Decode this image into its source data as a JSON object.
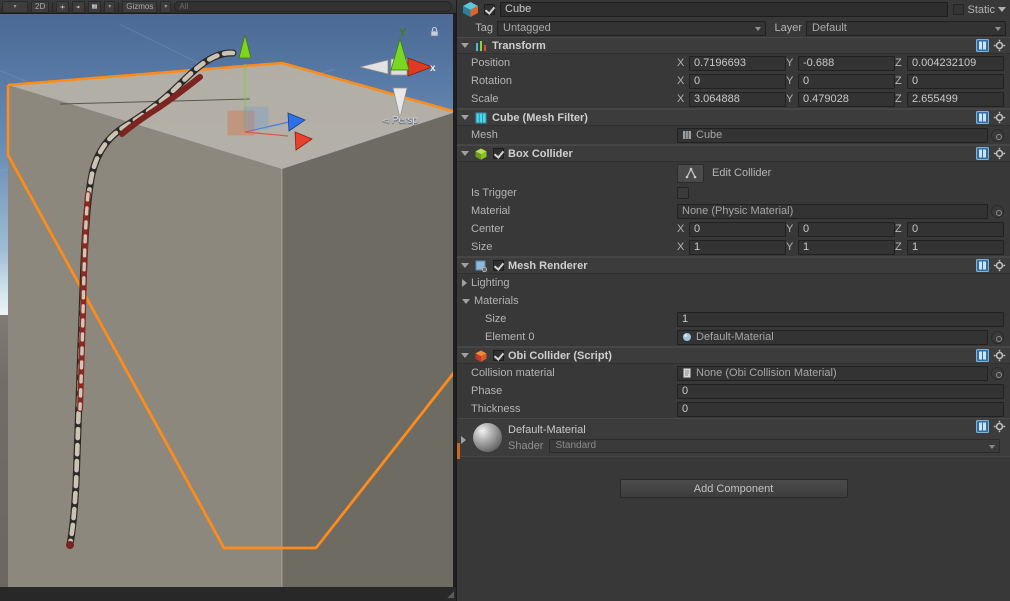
{
  "scene": {
    "toolbar": {
      "items": [
        {
          "name": "draw-mode-dropdown",
          "label": "",
          "icon": "dropdown"
        },
        {
          "name": "2d-toggle",
          "label": "2D",
          "icon": "text"
        },
        {
          "name": "scene-lighting-toggle",
          "label": "",
          "icon": "sun-icon"
        },
        {
          "name": "scene-audio-toggle",
          "label": "",
          "icon": "speaker-icon"
        },
        {
          "name": "scene-fx-dropdown",
          "label": "",
          "icon": "image-icon"
        },
        {
          "name": "scene-fx-caret",
          "label": "",
          "icon": "chevron-down-icon"
        },
        {
          "name": "gizmos-dropdown",
          "label": "Gizmos",
          "icon": "text"
        },
        {
          "name": "gizmos-caret",
          "label": "",
          "icon": "chevron-down-icon"
        }
      ],
      "search_placeholder": "All"
    },
    "gizmo": {
      "axis_y_label": "Y",
      "axis_x_label": "x",
      "projection_label": "Persp",
      "lock_icon": "lock-icon"
    },
    "colors": {
      "selection_outline": "#ff8c1a",
      "axis_x": "#e8412e",
      "axis_y": "#7fd41f",
      "axis_z": "#2f6fe8",
      "sky_top": "#4b6a95",
      "horizon": "#edf4f6",
      "ground": "#716e66"
    },
    "objects": {
      "selected": "Cube",
      "rope": "obi-rope"
    }
  },
  "inspector": {
    "gameobject": {
      "icon": "gameobject-cube-icon",
      "enabled": true,
      "name": "Cube",
      "static_label": "Static",
      "static_checked": false
    },
    "tag_row": {
      "tag_label": "Tag",
      "tag_value": "Untagged",
      "layer_label": "Layer",
      "layer_value": "Default"
    },
    "components": [
      {
        "id": "transform",
        "title": "Transform",
        "icon": "transform-icon",
        "expanded": true,
        "has_checkbox": false,
        "rows": [
          {
            "label": "Position",
            "type": "vector3",
            "x": "0.7196693",
            "y": "-0.688",
            "z": "0.004232109"
          },
          {
            "label": "Rotation",
            "type": "vector3",
            "x": "0",
            "y": "0",
            "z": "0"
          },
          {
            "label": "Scale",
            "type": "vector3",
            "x": "3.064888",
            "y": "0.479028",
            "z": "2.655499"
          }
        ]
      },
      {
        "id": "mesh-filter",
        "title": "Cube (Mesh Filter)",
        "icon": "mesh-filter-icon",
        "expanded": true,
        "has_checkbox": false,
        "rows": [
          {
            "label": "Mesh",
            "type": "object",
            "value": "Cube",
            "value_icon": "mesh-icon"
          }
        ]
      },
      {
        "id": "box-collider",
        "title": "Box Collider",
        "icon": "box-collider-icon",
        "expanded": true,
        "has_checkbox": true,
        "checked": true,
        "edit_collider": {
          "label": "Edit Collider",
          "icon": "edit-collider-icon"
        },
        "rows": [
          {
            "label": "Is Trigger",
            "type": "toggle",
            "checked": false
          },
          {
            "label": "Material",
            "type": "object",
            "value": "None (Physic Material)",
            "value_icon": ""
          },
          {
            "label": "Center",
            "type": "vector3",
            "x": "0",
            "y": "0",
            "z": "0"
          },
          {
            "label": "Size",
            "type": "vector3",
            "x": "1",
            "y": "1",
            "z": "1"
          }
        ]
      },
      {
        "id": "mesh-renderer",
        "title": "Mesh Renderer",
        "icon": "mesh-renderer-icon",
        "expanded": true,
        "has_checkbox": true,
        "checked": true,
        "rows": [
          {
            "label": "Lighting",
            "type": "foldout-closed"
          },
          {
            "label": "Materials",
            "type": "foldout-open"
          },
          {
            "label": "Size",
            "type": "text",
            "indent": true,
            "value": "1"
          },
          {
            "label": "Element 0",
            "type": "object",
            "indent": true,
            "value": "Default-Material",
            "value_icon": "material-icon"
          }
        ]
      },
      {
        "id": "obi-collider",
        "title": "Obi Collider (Script)",
        "icon": "obi-collider-icon",
        "expanded": true,
        "has_checkbox": true,
        "checked": true,
        "rows": [
          {
            "label": "Collision material",
            "type": "object",
            "value": "None (Obi Collision Material)",
            "value_icon": "script-icon"
          },
          {
            "label": "Phase",
            "type": "text",
            "value": "0"
          },
          {
            "label": "Thickness",
            "type": "text",
            "value": "0"
          }
        ]
      }
    ],
    "material_preview": {
      "name": "Default-Material",
      "shader_label": "Shader",
      "shader_value": "Standard",
      "icon": "material-sphere-preview"
    },
    "add_component_label": "Add Component"
  }
}
